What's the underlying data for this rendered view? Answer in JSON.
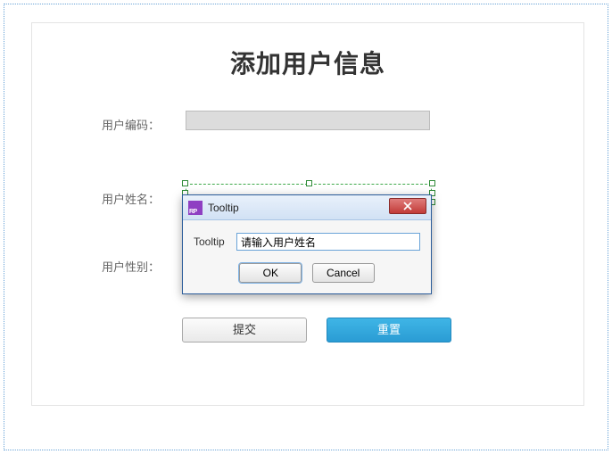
{
  "page": {
    "title": "添加用户信息"
  },
  "form": {
    "fields": {
      "code": {
        "label": "用户编码：",
        "value": ""
      },
      "name": {
        "label": "用户姓名：",
        "value": ""
      },
      "gender": {
        "label": "用户性别："
      }
    },
    "buttons": {
      "submit": "提交",
      "reset": "重置"
    }
  },
  "dialog": {
    "title": "Tooltip",
    "field_label": "Tooltip",
    "field_value": "请输入用户姓名",
    "ok": "OK",
    "cancel": "Cancel",
    "icon_name": "axure-rp-icon",
    "close_icon_name": "close-icon"
  }
}
